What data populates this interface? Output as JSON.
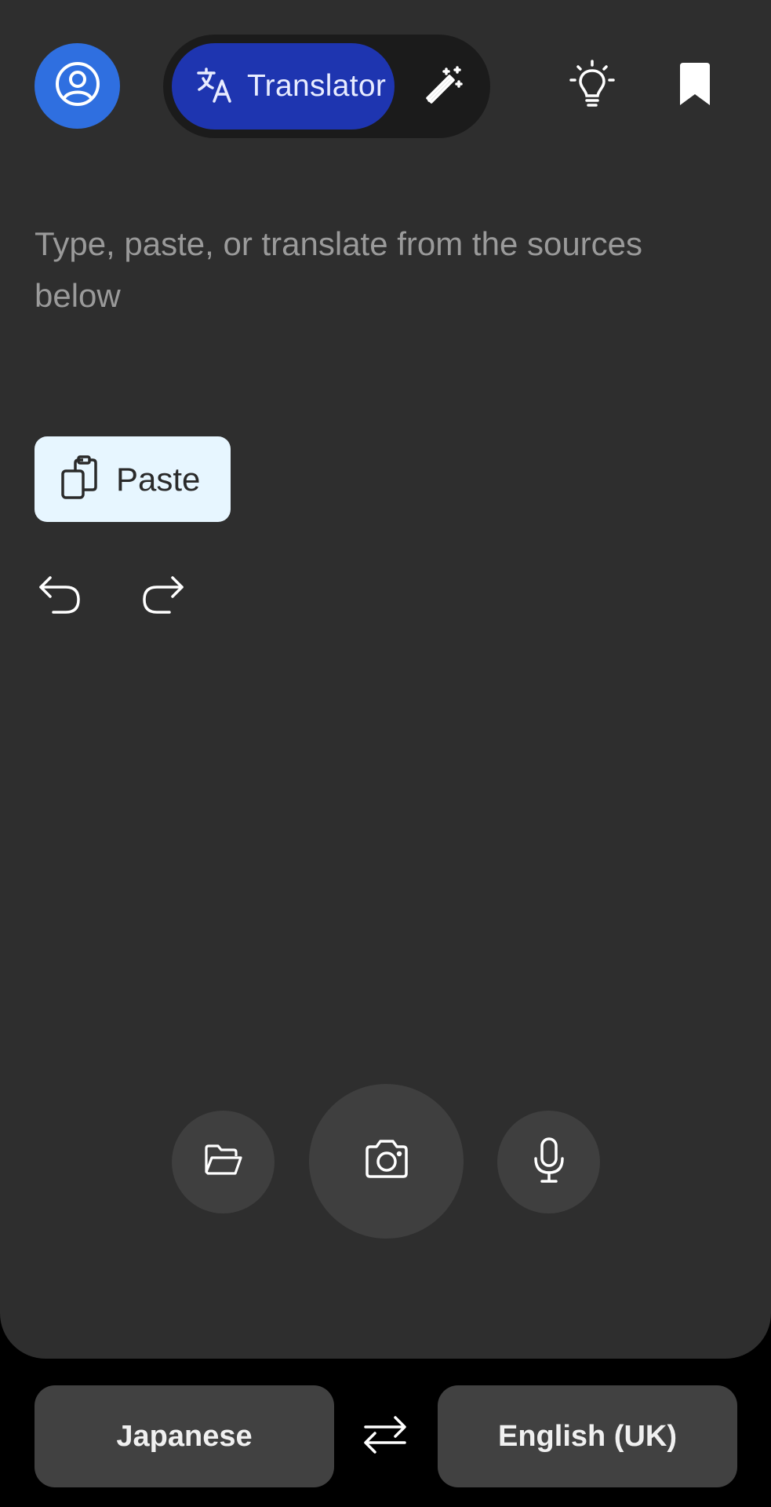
{
  "header": {
    "account_icon": "account-circle-icon",
    "mode_tabs": [
      {
        "label": "Translator",
        "icon": "translate-icon",
        "selected": true
      },
      {
        "label": "",
        "icon": "magic-wand-icon",
        "selected": false
      }
    ],
    "tips_icon": "lightbulb-icon",
    "saved_icon": "bookmark-icon"
  },
  "input": {
    "placeholder": "Type, paste, or translate from the sources below",
    "value": ""
  },
  "paste_button": {
    "label": "Paste",
    "icon": "clipboard-icon"
  },
  "history": {
    "undo_icon": "undo-icon",
    "redo_icon": "redo-icon"
  },
  "sources": [
    {
      "name": "file",
      "icon": "folder-icon"
    },
    {
      "name": "camera",
      "icon": "camera-icon"
    },
    {
      "name": "voice",
      "icon": "microphone-icon"
    }
  ],
  "languages": {
    "source": "Japanese",
    "target": "English (UK)",
    "swap_icon": "swap-arrows-icon"
  },
  "colors": {
    "background": "#000000",
    "card": "#2e2e2e",
    "accent": "#2f6fe0",
    "translator_tab": "#1e35b0",
    "paste_button": "#e7f6ff",
    "source_buttons": "#3f3f3f",
    "language_buttons": "#414141"
  }
}
